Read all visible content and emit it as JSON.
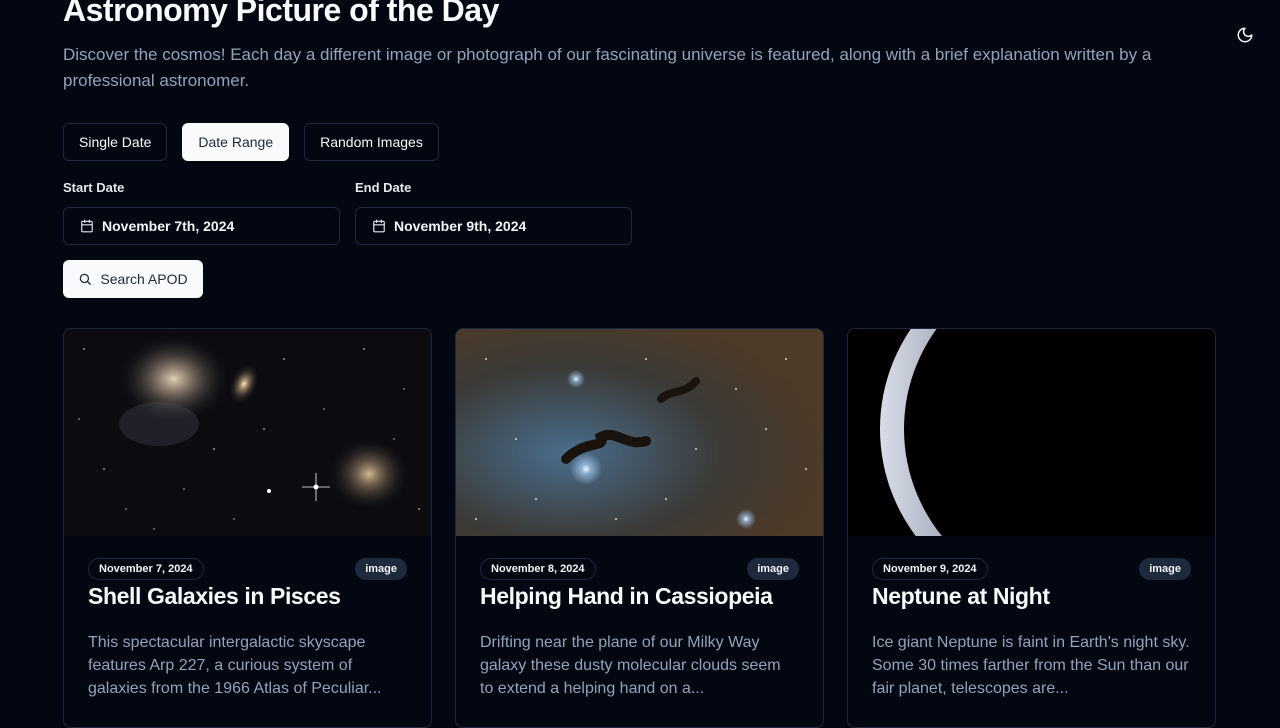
{
  "header": {
    "title": "Astronomy Picture of the Day",
    "subtitle": "Discover the cosmos! Each day a different image or photograph of our fascinating universe is featured, along with a brief explanation written by a professional astronomer.",
    "theme_toggle_icon": "moon-icon"
  },
  "mode_tabs": [
    {
      "label": "Single Date",
      "active": false
    },
    {
      "label": "Date Range",
      "active": true
    },
    {
      "label": "Random Images",
      "active": false
    }
  ],
  "form": {
    "start_label": "Start Date",
    "start_value": "November 7th, 2024",
    "end_label": "End Date",
    "end_value": "November 9th, 2024",
    "calendar_icon": "calendar-icon",
    "search_label": "Search APOD",
    "search_icon": "search-icon"
  },
  "cards": [
    {
      "date": "November 7, 2024",
      "media_type": "image",
      "title": "Shell Galaxies in Pisces",
      "description": "This spectacular intergalactic skyscape features Arp 227, a curious system of galaxies from the 1966 Atlas of Peculiar..."
    },
    {
      "date": "November 8, 2024",
      "media_type": "image",
      "title": "Helping Hand in Cassiopeia",
      "description": "Drifting near the plane of our Milky Way galaxy these dusty molecular clouds seem to extend a helping hand on a..."
    },
    {
      "date": "November 9, 2024",
      "media_type": "image",
      "title": "Neptune at Night",
      "description": "Ice giant Neptune is faint in Earth's night sky. Some 30 times farther from the Sun than our fair planet, telescopes are..."
    }
  ],
  "colors": {
    "background": "#030712",
    "border": "#1e293b",
    "text_primary": "#f8fafc",
    "text_muted": "#94a3b8"
  }
}
